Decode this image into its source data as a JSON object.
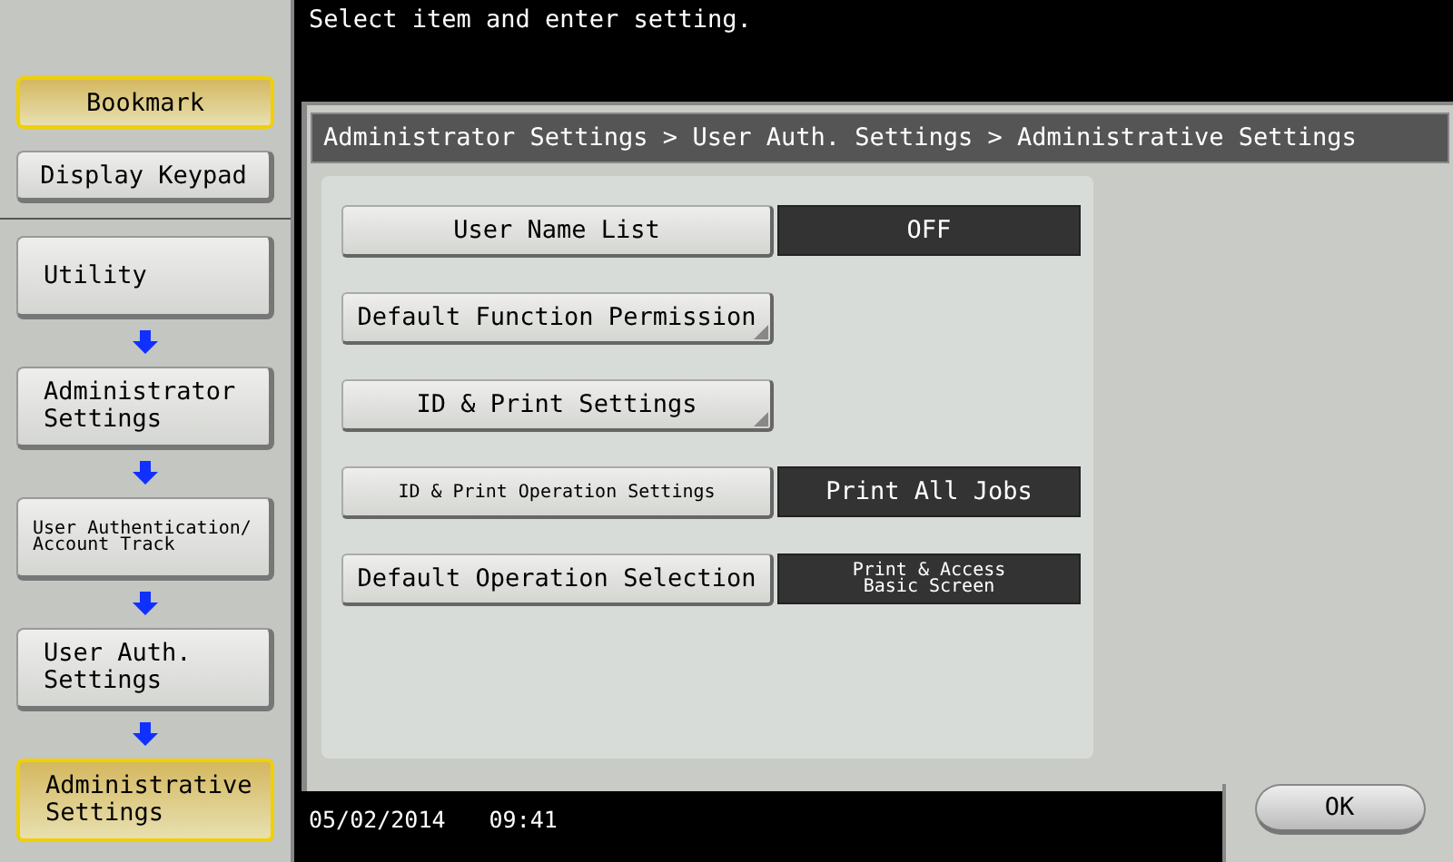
{
  "message": "Select item and enter setting.",
  "sidebar": {
    "top_buttons": [
      {
        "label": "Bookmark",
        "highlighted": true
      },
      {
        "label": "Display Keypad",
        "highlighted": false
      }
    ],
    "path": [
      {
        "label": "Utility",
        "kind": "normal",
        "selected": false
      },
      {
        "label": "Administrator Settings",
        "kind": "normal",
        "selected": false
      },
      {
        "label": "User Authentication/ Account Track",
        "kind": "small",
        "selected": false
      },
      {
        "label": "User Auth. Settings",
        "kind": "normal",
        "selected": false
      },
      {
        "label": "Administrative Settings",
        "kind": "normal",
        "selected": true
      }
    ]
  },
  "breadcrumb": "Administrator Settings > User Auth. Settings > Administrative Settings",
  "settings": [
    {
      "label": "User Name List",
      "kind": "normal",
      "submenu": false,
      "value": "OFF"
    },
    {
      "label": "Default Function Permission",
      "kind": "normal",
      "submenu": true
    },
    {
      "label": "ID & Print Settings",
      "kind": "normal",
      "submenu": true
    },
    {
      "label": "ID & Print Operation Settings",
      "kind": "small-label",
      "submenu": false,
      "value": "Print All Jobs"
    },
    {
      "label": "Default Operation Selection",
      "kind": "small-value",
      "submenu": false,
      "value": "Print & Access Basic Screen"
    }
  ],
  "status": {
    "date": "05/02/2014",
    "time": "09:41"
  },
  "ok_button": "OK"
}
